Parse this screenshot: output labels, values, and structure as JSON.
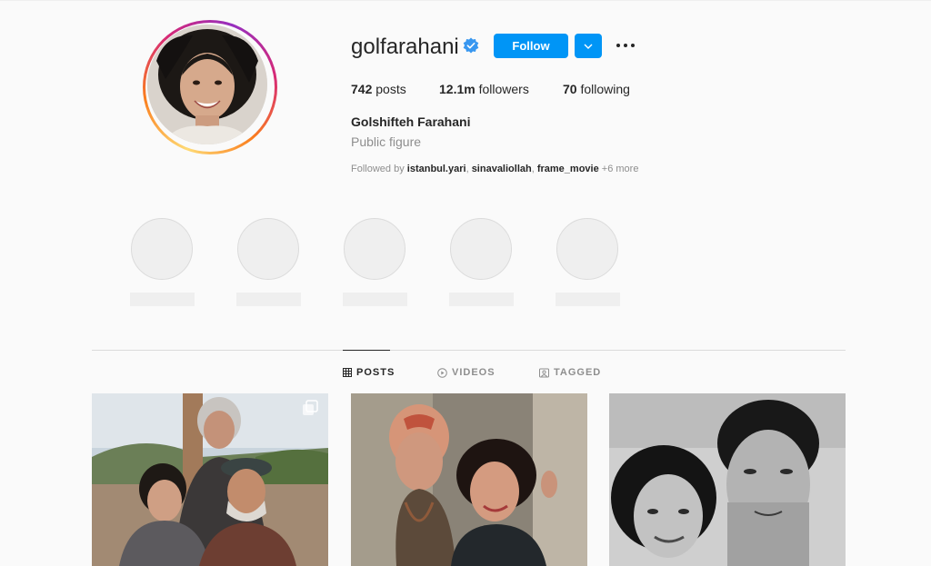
{
  "profile": {
    "username": "golfarahani",
    "full_name": "Golshifteh Farahani",
    "category": "Public figure",
    "verified": true,
    "follow_label": "Follow"
  },
  "stats": {
    "posts_count": "742",
    "posts_label": "posts",
    "followers_count": "12.1m",
    "followers_label": "followers",
    "following_count": "70",
    "following_label": "following"
  },
  "followed_by": {
    "prefix": "Followed by ",
    "users": [
      "istanbul.yari",
      "sinavaliollah",
      "frame_movie"
    ],
    "sep1": ", ",
    "sep2": ", ",
    "more": " +6 more"
  },
  "tabs": [
    {
      "label": "POSTS",
      "icon": "grid-icon",
      "active": true
    },
    {
      "label": "VIDEOS",
      "icon": "play-circle-icon",
      "active": false
    },
    {
      "label": "TAGGED",
      "icon": "tag-person-icon",
      "active": false
    }
  ],
  "posts": [
    {
      "type": "carousel"
    },
    {
      "type": "image"
    },
    {
      "type": "image"
    }
  ],
  "colors": {
    "accent": "#0095f6",
    "background": "#fafafa",
    "text": "#262626",
    "muted": "#8e8e8e",
    "border": "#dbdbdb"
  }
}
